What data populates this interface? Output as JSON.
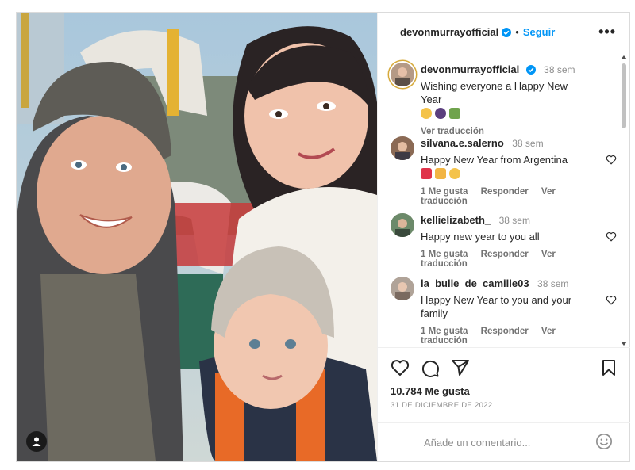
{
  "post": {
    "author": "devonmurrayofficial",
    "follow_label": "Seguir",
    "more_icon": "more-options-icon",
    "caption": {
      "username": "devonmurrayofficial",
      "time": "38 sem",
      "text": "Wishing everyone a Happy New Year",
      "emojis": [
        "smiling-face-emoji",
        "fireworks-emoji",
        "champagne-emoji"
      ],
      "translate": "Ver traducción"
    },
    "comments": [
      {
        "username": "silvana.e.salerno",
        "time": "38 sem",
        "text": "Happy New Year from Argentina",
        "emojis": [
          "red-heart-emoji",
          "clapping-hands-emoji",
          "smiling-face-emoji"
        ],
        "likes": "1 Me gusta",
        "reply": "Responder",
        "translate": "Ver traducción"
      },
      {
        "username": "kellielizabeth_",
        "time": "38 sem",
        "text": "Happy new year to you all",
        "likes": "1 Me gusta",
        "reply": "Responder",
        "translate": "Ver traducción"
      },
      {
        "username": "la_bulle_de_camille03",
        "time": "38 sem",
        "text": "Happy New Year to you and your family",
        "likes": "1 Me gusta",
        "reply": "Responder",
        "translate": "Ver traducción"
      }
    ],
    "likes_count": "10.784 Me gusta",
    "date": "31 DE DICIEMBRE DE 2022",
    "comment_placeholder": "Añade un comentario...",
    "colors": {
      "accent": "#0095f6",
      "verified": "#0095f6",
      "text": "#262626",
      "muted": "#8e8e8e",
      "border": "#dbdbdb"
    }
  }
}
